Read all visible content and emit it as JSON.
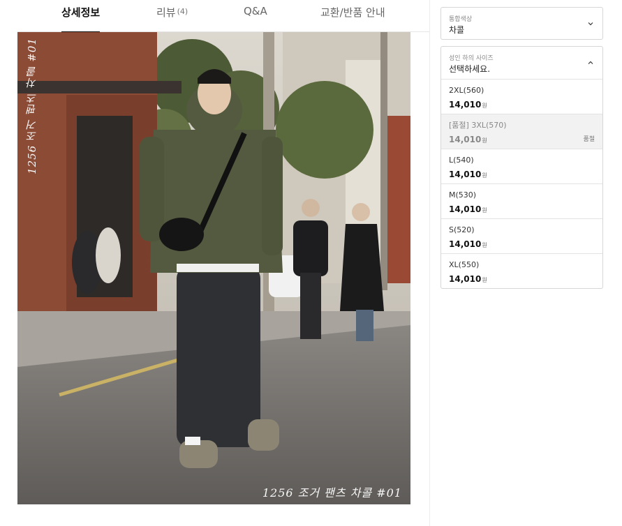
{
  "tabs": [
    {
      "label": "상세정보",
      "count": ""
    },
    {
      "label": "리뷰",
      "count": "(4)"
    },
    {
      "label": "Q&A",
      "count": ""
    },
    {
      "label": "교환/반품 안내",
      "count": ""
    }
  ],
  "photo": {
    "caption_bottom": "1256 조거 팬츠 차콜 #01",
    "caption_side": "1256 조거 팬츠 차콜 #01"
  },
  "options": {
    "color": {
      "label": "통합색상",
      "value": "차콜"
    },
    "size": {
      "label": "성인 하의 사이즈",
      "placeholder": "선택하세요."
    },
    "sizes": [
      {
        "name": "2XL(560)",
        "price": "14,010",
        "unit": "원",
        "badge": ""
      },
      {
        "name": "[품절] 3XL(570)",
        "price": "14,010",
        "unit": "원",
        "badge": "품절"
      },
      {
        "name": "L(540)",
        "price": "14,010",
        "unit": "원",
        "badge": ""
      },
      {
        "name": "M(530)",
        "price": "14,010",
        "unit": "원",
        "badge": ""
      },
      {
        "name": "S(520)",
        "price": "14,010",
        "unit": "원",
        "badge": ""
      },
      {
        "name": "XL(550)",
        "price": "14,010",
        "unit": "원",
        "badge": ""
      }
    ]
  },
  "colors": {
    "active_tab": "#111111",
    "soldout_bg": "#f2f2f2",
    "border": "#d6d6d6"
  },
  "icons": {
    "color_select": "chevron-down-icon",
    "size_select": "chevron-up-icon"
  }
}
